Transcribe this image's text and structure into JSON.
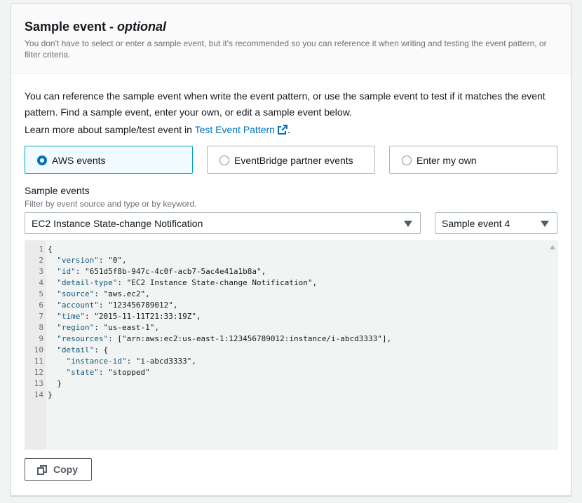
{
  "header": {
    "title_main": "Sample event - ",
    "title_optional": "optional",
    "subtitle": "You don't have to select or enter a sample event, but it's recommended so you can reference it when writing and testing the event pattern, or filter criteria."
  },
  "intro": {
    "description": "You can reference the sample event when write the event pattern, or use the sample event to test if it matches the event pattern. Find a sample event, enter your own, or edit a sample event below.",
    "learn_prefix": "Learn more about sample/test event in ",
    "learn_link": "Test Event Pattern",
    "learn_suffix": "."
  },
  "event_type": {
    "options": [
      {
        "label": "AWS events",
        "selected": true
      },
      {
        "label": "EventBridge partner events",
        "selected": false
      },
      {
        "label": "Enter my own",
        "selected": false
      }
    ]
  },
  "sample_events": {
    "label": "Sample events",
    "description": "Filter by event source and type or by keyword.",
    "event_select": "EC2 Instance State-change Notification",
    "sample_select": "Sample event 4"
  },
  "editor": {
    "lines": [
      {
        "n": "1",
        "indent": "",
        "key": "",
        "rest": "{"
      },
      {
        "n": "2",
        "indent": "  ",
        "key": "\"version\"",
        "rest": ": \"0\","
      },
      {
        "n": "3",
        "indent": "  ",
        "key": "\"id\"",
        "rest": ": \"651d5f8b-947c-4c0f-acb7-5ac4e41a1b8a\","
      },
      {
        "n": "4",
        "indent": "  ",
        "key": "\"detail-type\"",
        "rest": ": \"EC2 Instance State-change Notification\","
      },
      {
        "n": "5",
        "indent": "  ",
        "key": "\"source\"",
        "rest": ": \"aws.ec2\","
      },
      {
        "n": "6",
        "indent": "  ",
        "key": "\"account\"",
        "rest": ": \"123456789012\","
      },
      {
        "n": "7",
        "indent": "  ",
        "key": "\"time\"",
        "rest": ": \"2015-11-11T21:33:19Z\","
      },
      {
        "n": "8",
        "indent": "  ",
        "key": "\"region\"",
        "rest": ": \"us-east-1\","
      },
      {
        "n": "9",
        "indent": "  ",
        "key": "\"resources\"",
        "rest": ": [\"arn:aws:ec2:us-east-1:123456789012:instance/i-abcd3333\"],"
      },
      {
        "n": "10",
        "indent": "  ",
        "key": "\"detail\"",
        "rest": ": {"
      },
      {
        "n": "11",
        "indent": "    ",
        "key": "\"instance-id\"",
        "rest": ": \"i-abcd3333\","
      },
      {
        "n": "12",
        "indent": "    ",
        "key": "\"state\"",
        "rest": ": \"stopped\""
      },
      {
        "n": "13",
        "indent": "  ",
        "key": "",
        "rest": "}"
      },
      {
        "n": "14",
        "indent": "",
        "key": "",
        "rest": "}"
      }
    ]
  },
  "copy_button": {
    "label": "Copy",
    "icon": "copy-icon"
  },
  "colors": {
    "accent": "#0073bb",
    "selected_border": "#00a1c9",
    "selected_bg": "#f1faff"
  }
}
